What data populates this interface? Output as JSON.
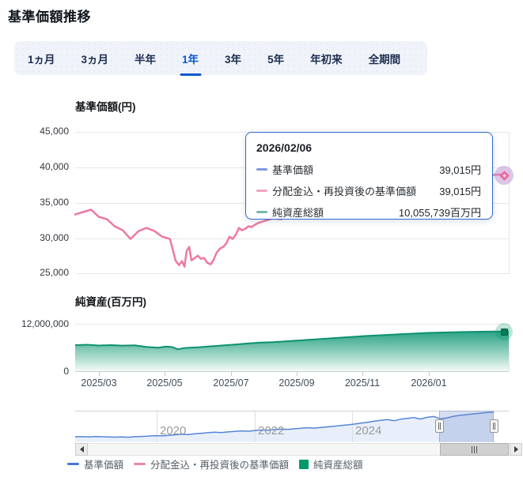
{
  "page": {
    "title": "基準価額推移"
  },
  "tabs": {
    "items": [
      {
        "label": "1ヵ月",
        "selected": false
      },
      {
        "label": "3ヵ月",
        "selected": false
      },
      {
        "label": "半年",
        "selected": false
      },
      {
        "label": "1年",
        "selected": true
      },
      {
        "label": "3年",
        "selected": false
      },
      {
        "label": "5年",
        "selected": false
      },
      {
        "label": "年初来",
        "selected": false
      },
      {
        "label": "全期間",
        "selected": false
      }
    ],
    "selected_color": "#0b57d0"
  },
  "price_chart": {
    "title": "基準価額(円)",
    "y_ticks": [
      "45,000",
      "40,000",
      "35,000",
      "30,000",
      "25,000"
    ]
  },
  "asset_chart": {
    "title": "純資産(百万円)",
    "y_ticks": [
      "12,000,000",
      "0"
    ],
    "x_ticks": [
      "2025/03",
      "2025/05",
      "2025/07",
      "2025/09",
      "2025/11",
      "2026/01"
    ]
  },
  "tooltip": {
    "date": "2026/02/06",
    "rows": [
      {
        "label": "基準価額",
        "value": "39,015円",
        "color": "#7b99de"
      },
      {
        "label": "分配金込・再投資後の基準価額",
        "value": "39,015円",
        "color": "#f2a3bd"
      },
      {
        "label": "純資産総額",
        "value": "10,055,739百万円",
        "color": "#79b8aa"
      }
    ],
    "border_color": "#2e6ac9"
  },
  "navigator": {
    "year_labels": [
      "2020",
      "2022",
      "2024"
    ],
    "selection": {
      "start": 0.87,
      "end": 1.0
    }
  },
  "legend": {
    "items": [
      {
        "label": "基準価額",
        "color": "#4678d2",
        "shape": "dash"
      },
      {
        "label": "分配金込・再投資後の基準価額",
        "color": "#ef85ac",
        "shape": "dash"
      },
      {
        "label": "純資産総額",
        "color": "#009a68",
        "shape": "square"
      }
    ]
  },
  "chart_data": [
    {
      "type": "line",
      "name": "分配金込・再投資後の基準価額 (1年)",
      "color": "#ee78a2",
      "x_range": [
        "2025/02/06",
        "2026/02/06"
      ],
      "ylim": [
        25000,
        45000
      ],
      "unit": "円",
      "last_value": 39015,
      "points": [
        [
          0,
          33350
        ],
        [
          0.018,
          33690
        ],
        [
          0.037,
          34020
        ],
        [
          0.055,
          33020
        ],
        [
          0.074,
          32680
        ],
        [
          0.092,
          31680
        ],
        [
          0.111,
          31120
        ],
        [
          0.129,
          29890
        ],
        [
          0.148,
          31010
        ],
        [
          0.166,
          31450
        ],
        [
          0.185,
          31010
        ],
        [
          0.203,
          30220
        ],
        [
          0.221,
          29890
        ],
        [
          0.227,
          28550
        ],
        [
          0.234,
          26870
        ],
        [
          0.242,
          26200
        ],
        [
          0.249,
          26760
        ],
        [
          0.255,
          25980
        ],
        [
          0.26,
          28210
        ],
        [
          0.266,
          28770
        ],
        [
          0.271,
          26870
        ],
        [
          0.279,
          27210
        ],
        [
          0.286,
          27540
        ],
        [
          0.293,
          27100
        ],
        [
          0.301,
          27210
        ],
        [
          0.308,
          26540
        ],
        [
          0.316,
          26310
        ],
        [
          0.323,
          26980
        ],
        [
          0.33,
          27990
        ],
        [
          0.338,
          28550
        ],
        [
          0.345,
          28770
        ],
        [
          0.352,
          29220
        ],
        [
          0.36,
          30220
        ],
        [
          0.367,
          29890
        ],
        [
          0.375,
          30560
        ],
        [
          0.382,
          31450
        ],
        [
          0.389,
          31120
        ],
        [
          0.397,
          31340
        ],
        [
          0.404,
          31680
        ],
        [
          0.411,
          31560
        ],
        [
          0.419,
          31900
        ],
        [
          0.426,
          32120
        ],
        [
          0.443,
          32460
        ],
        [
          0.461,
          32790
        ],
        [
          0.48,
          32680
        ],
        [
          0.498,
          33240
        ],
        [
          0.517,
          33580
        ],
        [
          0.535,
          33350
        ],
        [
          0.554,
          33910
        ],
        [
          0.572,
          34250
        ],
        [
          0.59,
          34020
        ],
        [
          0.609,
          34800
        ],
        [
          0.627,
          35140
        ],
        [
          0.646,
          34920
        ],
        [
          0.664,
          35470
        ],
        [
          0.683,
          35810
        ],
        [
          0.701,
          35590
        ],
        [
          0.72,
          36140
        ],
        [
          0.738,
          36480
        ],
        [
          0.757,
          36260
        ],
        [
          0.775,
          36810
        ],
        [
          0.793,
          37150
        ],
        [
          0.812,
          36930
        ],
        [
          0.83,
          37480
        ],
        [
          0.849,
          37820
        ],
        [
          0.867,
          37600
        ],
        [
          0.886,
          38150
        ],
        [
          0.904,
          38380
        ],
        [
          0.922,
          38150
        ],
        [
          0.941,
          38600
        ],
        [
          0.959,
          38820
        ],
        [
          0.978,
          38940
        ],
        [
          1,
          39015
        ]
      ]
    },
    {
      "type": "area",
      "name": "純資産総額 (1年)",
      "color": "#0d9170",
      "x_range": [
        "2025/02/06",
        "2026/02/06"
      ],
      "ylim": [
        0,
        12000000
      ],
      "unit": "百万円",
      "last_value": 10055739,
      "points": [
        [
          0,
          6600000
        ],
        [
          0.027,
          6700000
        ],
        [
          0.055,
          6500000
        ],
        [
          0.082,
          6600000
        ],
        [
          0.109,
          6480000
        ],
        [
          0.137,
          6550000
        ],
        [
          0.164,
          6150000
        ],
        [
          0.192,
          5950000
        ],
        [
          0.21,
          6250000
        ],
        [
          0.224,
          6100000
        ],
        [
          0.237,
          5550000
        ],
        [
          0.25,
          5850000
        ],
        [
          0.265,
          5950000
        ],
        [
          0.283,
          6050000
        ],
        [
          0.301,
          6200000
        ],
        [
          0.319,
          6350000
        ],
        [
          0.338,
          6500000
        ],
        [
          0.356,
          6650000
        ],
        [
          0.374,
          6800000
        ],
        [
          0.401,
          7050000
        ],
        [
          0.429,
          7250000
        ],
        [
          0.456,
          7350000
        ],
        [
          0.484,
          7550000
        ],
        [
          0.511,
          7750000
        ],
        [
          0.538,
          7950000
        ],
        [
          0.566,
          8150000
        ],
        [
          0.593,
          8350000
        ],
        [
          0.62,
          8550000
        ],
        [
          0.648,
          8750000
        ],
        [
          0.675,
          8950000
        ],
        [
          0.703,
          9100000
        ],
        [
          0.73,
          9250000
        ],
        [
          0.757,
          9400000
        ],
        [
          0.785,
          9550000
        ],
        [
          0.812,
          9700000
        ],
        [
          0.839,
          9780000
        ],
        [
          0.867,
          9850000
        ],
        [
          0.894,
          9920000
        ],
        [
          0.922,
          9980000
        ],
        [
          0.949,
          10020000
        ],
        [
          0.967,
          10040000
        ],
        [
          0.989,
          10055739
        ],
        [
          1,
          10055739
        ]
      ]
    },
    {
      "type": "line",
      "name": "基準価額 (全期間ナビゲーター)",
      "color": "#5585d6",
      "fill_color": "#e8effa",
      "x_range": [
        "2018",
        "2026/02"
      ],
      "ylim": [
        13000,
        39015
      ],
      "points": [
        [
          0,
          17200
        ],
        [
          0.016,
          17300
        ],
        [
          0.032,
          17100
        ],
        [
          0.048,
          17400
        ],
        [
          0.063,
          17250
        ],
        [
          0.079,
          17100
        ],
        [
          0.095,
          16900
        ],
        [
          0.111,
          17050
        ],
        [
          0.127,
          16800
        ],
        [
          0.143,
          17200
        ],
        [
          0.159,
          17500
        ],
        [
          0.175,
          17800
        ],
        [
          0.19,
          18200
        ],
        [
          0.206,
          18000
        ],
        [
          0.222,
          18500
        ],
        [
          0.238,
          19000
        ],
        [
          0.254,
          19400
        ],
        [
          0.27,
          19200
        ],
        [
          0.286,
          19800
        ],
        [
          0.302,
          20300
        ],
        [
          0.317,
          20800
        ],
        [
          0.333,
          21200
        ],
        [
          0.349,
          20900
        ],
        [
          0.365,
          21500
        ],
        [
          0.381,
          22000
        ],
        [
          0.397,
          22400
        ],
        [
          0.413,
          22100
        ],
        [
          0.429,
          22800
        ],
        [
          0.444,
          23200
        ],
        [
          0.46,
          23000
        ],
        [
          0.476,
          23600
        ],
        [
          0.492,
          24000
        ],
        [
          0.508,
          23700
        ],
        [
          0.524,
          24300
        ],
        [
          0.54,
          24800
        ],
        [
          0.556,
          25200
        ],
        [
          0.571,
          24900
        ],
        [
          0.587,
          25500
        ],
        [
          0.603,
          26000
        ],
        [
          0.619,
          26500
        ],
        [
          0.635,
          27200
        ],
        [
          0.651,
          27800
        ],
        [
          0.667,
          28500
        ],
        [
          0.683,
          29300
        ],
        [
          0.698,
          30100
        ],
        [
          0.714,
          31000
        ],
        [
          0.73,
          31800
        ],
        [
          0.746,
          32500
        ],
        [
          0.762,
          31500
        ],
        [
          0.778,
          32800
        ],
        [
          0.794,
          33500
        ],
        [
          0.81,
          34200
        ],
        [
          0.825,
          33000
        ],
        [
          0.841,
          34500
        ],
        [
          0.857,
          35200
        ],
        [
          0.873,
          33200
        ],
        [
          0.889,
          34000
        ],
        [
          0.905,
          35500
        ],
        [
          0.921,
          36300
        ],
        [
          0.937,
          37000
        ],
        [
          0.952,
          37600
        ],
        [
          0.968,
          38200
        ],
        [
          0.984,
          38800
        ],
        [
          1,
          39015
        ]
      ]
    }
  ]
}
